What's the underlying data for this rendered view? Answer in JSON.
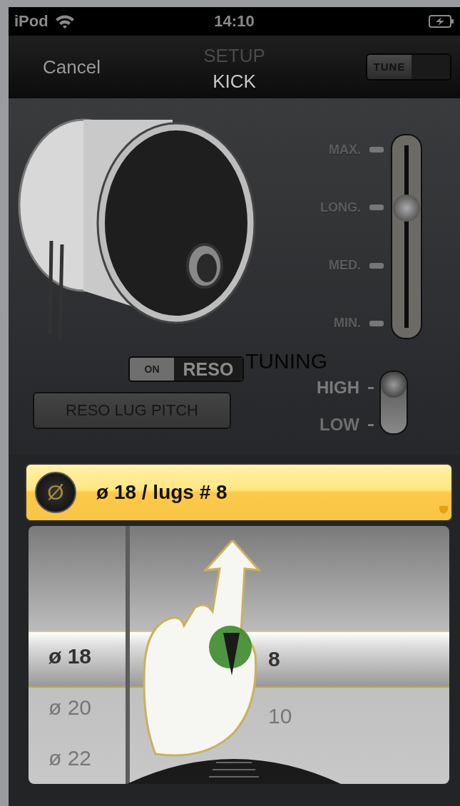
{
  "status_bar": {
    "carrier": "iPod",
    "time": "14:10"
  },
  "nav_bar": {
    "cancel": "Cancel",
    "title": "SETUP",
    "subtitle": "KICK",
    "tune_toggle": {
      "label": "TUNE",
      "on": false
    }
  },
  "decay_slider": {
    "level": 0.667,
    "stops": [
      "MAX.",
      "LONG.",
      "MED.",
      "MIN."
    ]
  },
  "reso_switch": {
    "state_label": "ON",
    "label": "RESO",
    "on": false
  },
  "reso_lug_pitch_button": "RESO LUG PITCH",
  "tuning": {
    "title": "TUNING",
    "options": [
      {
        "label": "HIGH",
        "selected": true
      },
      {
        "label": "LOW",
        "selected": false
      }
    ]
  },
  "selection_bar": {
    "icon_glyph": "Ø",
    "text": "ø 18 / lugs # 8"
  },
  "picker": {
    "columns": [
      {
        "rows": [
          {
            "label": "ø 18",
            "selected": true
          },
          {
            "label": "ø 20",
            "selected": false
          },
          {
            "label": "ø 22",
            "selected": false
          }
        ]
      },
      {
        "rows": [
          {
            "label": "8",
            "selected": true
          },
          {
            "label": "10",
            "selected": false
          }
        ]
      }
    ]
  }
}
